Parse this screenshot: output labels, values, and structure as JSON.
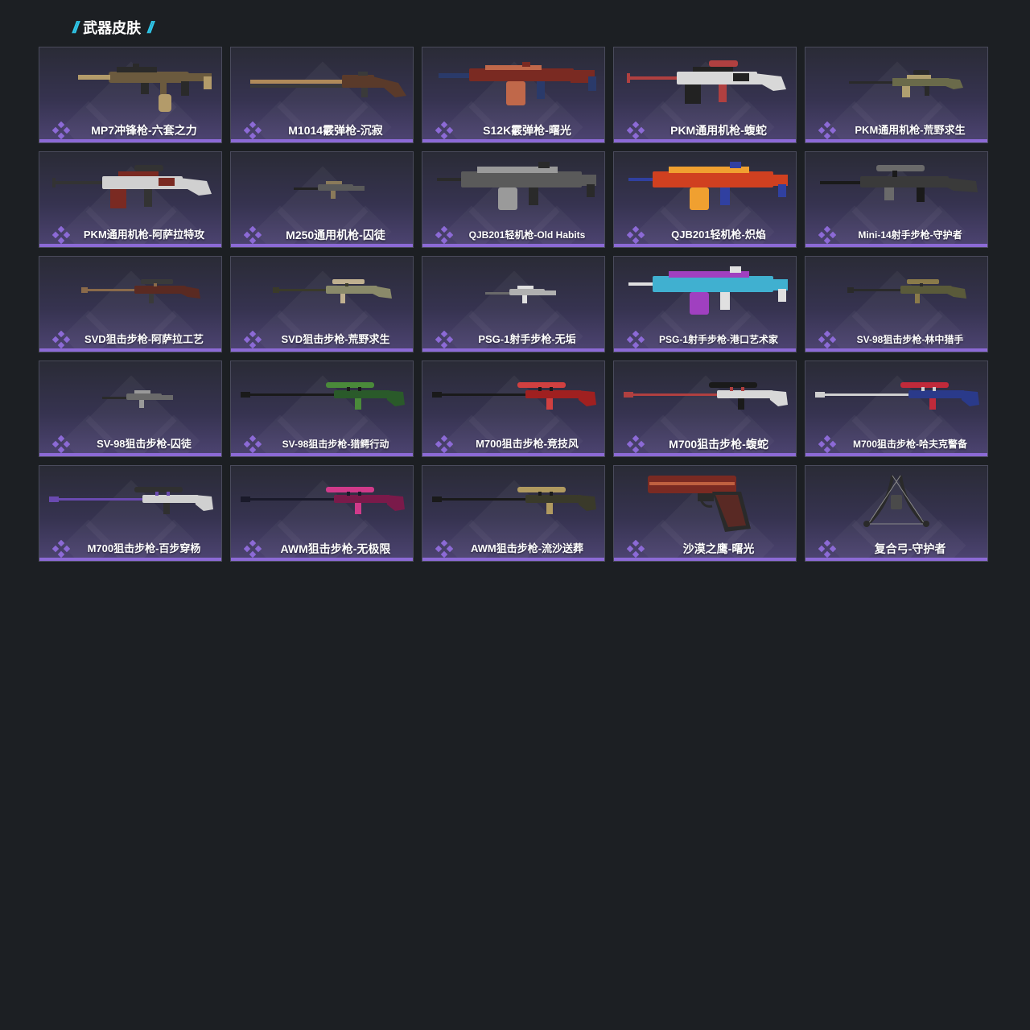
{
  "section": {
    "title": "武器皮肤",
    "accent_color": "#2fc6e8"
  },
  "theme": {
    "rarity_color": "#8c6ad6",
    "rarity_icon": "diamond-cluster-icon"
  },
  "skins": [
    {
      "name": "MP7冲锋枪-六套之力",
      "weapon": "smg",
      "colors": [
        "#6b5a3e",
        "#b39b6a",
        "#2a2a2a"
      ]
    },
    {
      "name": "M1014霰弹枪-沉寂",
      "weapon": "shotgun",
      "colors": [
        "#5a3a2a",
        "#b08a5a",
        "#3a3a3a"
      ]
    },
    {
      "name": "S12K霰弹枪-曙光",
      "weapon": "shotgun-box",
      "colors": [
        "#7a2a22",
        "#c0684a",
        "#2a3a6a"
      ]
    },
    {
      "name": "PKM通用机枪-蝮蛇",
      "weapon": "mg",
      "colors": [
        "#d8d8d8",
        "#222222",
        "#b04040"
      ]
    },
    {
      "name": "PKM通用机枪-荒野求生",
      "weapon": "mg-small",
      "colors": [
        "#6a6a4a",
        "#b0a070",
        "#2a2a2a"
      ]
    },
    {
      "name": "PKM通用机枪-阿萨拉特攻",
      "weapon": "mg",
      "colors": [
        "#d0d0d0",
        "#7a2a22",
        "#333333"
      ]
    },
    {
      "name": "M250通用机枪-囚徒",
      "weapon": "tiny",
      "colors": [
        "#5a5a5a",
        "#8a7a5a",
        "#222222"
      ]
    },
    {
      "name": "QJB201轻机枪-Old Habits",
      "weapon": "lmg",
      "colors": [
        "#5a5a5a",
        "#9a9a9a",
        "#2a2a2a"
      ]
    },
    {
      "name": "QJB201轻机枪-炽焰",
      "weapon": "lmg",
      "colors": [
        "#d04020",
        "#f0a030",
        "#3040a0"
      ]
    },
    {
      "name": "Mini-14射手步枪-守护者",
      "weapon": "rifle",
      "colors": [
        "#3a3a3a",
        "#6a6a6a",
        "#1a1a1a"
      ]
    },
    {
      "name": "SVD狙击步枪-阿萨拉工艺",
      "weapon": "sniper-small",
      "colors": [
        "#5a2a22",
        "#3a3a3a",
        "#8a6a4a"
      ]
    },
    {
      "name": "SVD狙击步枪-荒野求生",
      "weapon": "sniper-small",
      "colors": [
        "#8a8a6a",
        "#c0b090",
        "#3a3a2a"
      ]
    },
    {
      "name": "PSG-1射手步枪-无垢",
      "weapon": "tiny",
      "colors": [
        "#b0b0b0",
        "#e0e0e0",
        "#6a6a6a"
      ]
    },
    {
      "name": "PSG-1射手步枪-港口艺术家",
      "weapon": "lmg",
      "colors": [
        "#40b0d0",
        "#a040c0",
        "#e0e0e0"
      ]
    },
    {
      "name": "SV-98狙击步枪-林中猎手",
      "weapon": "sniper-small",
      "colors": [
        "#5a5a3a",
        "#8a7a4a",
        "#2a2a2a"
      ]
    },
    {
      "name": "SV-98狙击步枪-囚徒",
      "weapon": "tiny",
      "colors": [
        "#6a6a6a",
        "#9a9a9a",
        "#2a2a2a"
      ]
    },
    {
      "name": "SV-98狙击步枪-猎鳄行动",
      "weapon": "sniper",
      "colors": [
        "#2a5a2a",
        "#4a8a3a",
        "#1a1a1a"
      ]
    },
    {
      "name": "M700狙击步枪-竞技风",
      "weapon": "sniper",
      "colors": [
        "#a02020",
        "#d04040",
        "#1a1a1a"
      ]
    },
    {
      "name": "M700狙击步枪-蝮蛇",
      "weapon": "sniper",
      "colors": [
        "#d8d8d8",
        "#1a1a1a",
        "#b04040"
      ]
    },
    {
      "name": "M700狙击步枪-哈夫克警备",
      "weapon": "sniper",
      "colors": [
        "#2a3a8a",
        "#c02a3a",
        "#d0d0d0"
      ]
    },
    {
      "name": "M700狙击步枪-百步穿杨",
      "weapon": "sniper",
      "colors": [
        "#d0d0d0",
        "#303030",
        "#6a4ab0"
      ]
    },
    {
      "name": "AWM狙击步枪-无极限",
      "weapon": "sniper",
      "colors": [
        "#7a1a4a",
        "#d03a8a",
        "#1a1a2a"
      ]
    },
    {
      "name": "AWM狙击步枪-流沙送葬",
      "weapon": "sniper",
      "colors": [
        "#3a3a2a",
        "#b09a60",
        "#1a1a1a"
      ]
    },
    {
      "name": "沙漠之鹰-曙光",
      "weapon": "pistol",
      "colors": [
        "#7a2a22",
        "#2a2a2a",
        "#c06040"
      ]
    },
    {
      "name": "复合弓-守护者",
      "weapon": "bow",
      "colors": [
        "#2a2a2a",
        "#8a8a8a",
        "#4a4a4a"
      ]
    }
  ]
}
